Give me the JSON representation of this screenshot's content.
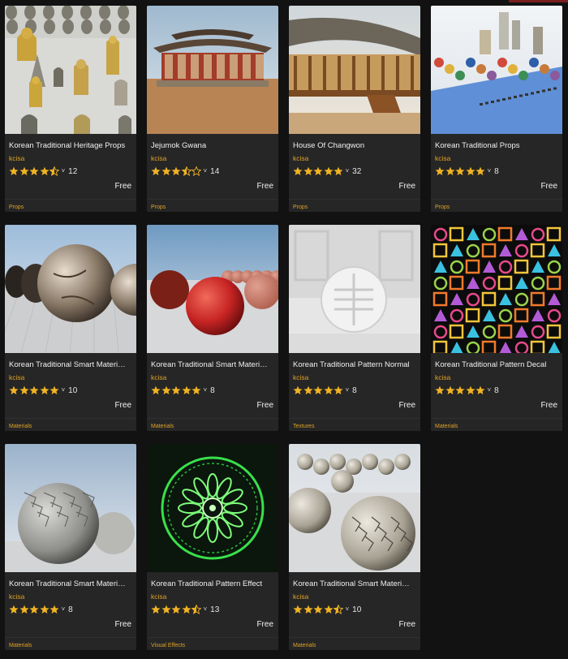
{
  "colors": {
    "page_bg": "#121212",
    "card_bg": "#262626",
    "accent": "#e0a224",
    "star": "#f0b323"
  },
  "products": [
    {
      "title": "Korean Traditional Heritage Props",
      "seller": "kcisa",
      "rating": 4.5,
      "reviews": "12",
      "price": "Free",
      "category": "Props",
      "thumb": "heritage-props"
    },
    {
      "title": "Jejumok Gwana",
      "seller": "kcisa",
      "rating": 3.5,
      "reviews": "14",
      "price": "Free",
      "category": "Props",
      "thumb": "jejumok-gwana"
    },
    {
      "title": "House Of Changwon",
      "seller": "kcisa",
      "rating": 5,
      "reviews": "32",
      "price": "Free",
      "category": "Props",
      "thumb": "house-changwon"
    },
    {
      "title": "Korean Traditional Props",
      "seller": "kcisa",
      "rating": 5,
      "reviews": "8",
      "price": "Free",
      "category": "Props",
      "thumb": "traditional-props"
    },
    {
      "title": "Korean Traditional Smart Materi…",
      "seller": "kcisa",
      "rating": 5,
      "reviews": "10",
      "price": "Free",
      "category": "Materials",
      "thumb": "marble-spheres"
    },
    {
      "title": "Korean Traditional Smart Materi…",
      "seller": "kcisa",
      "rating": 5,
      "reviews": "8",
      "price": "Free",
      "category": "Materials",
      "thumb": "red-spheres"
    },
    {
      "title": "Korean Traditional Pattern Normal",
      "seller": "kcisa",
      "rating": 5,
      "reviews": "8",
      "price": "Free",
      "category": "Textures",
      "thumb": "pattern-normal"
    },
    {
      "title": "Korean Traditional Pattern Decal",
      "seller": "kcisa",
      "rating": 5,
      "reviews": "8",
      "price": "Free",
      "category": "Materials",
      "thumb": "pattern-decal"
    },
    {
      "title": "Korean Traditional Smart Materi…",
      "seller": "kcisa",
      "rating": 5,
      "reviews": "8",
      "price": "Free",
      "category": "Materials",
      "thumb": "stone-sphere"
    },
    {
      "title": "Korean Traditional Pattern Effect",
      "seller": "kcisa",
      "rating": 4.5,
      "reviews": "13",
      "price": "Free",
      "category": "Visual Effects",
      "thumb": "pattern-effect"
    },
    {
      "title": "Korean Traditional Smart Materi…",
      "seller": "kcisa",
      "rating": 4.5,
      "reviews": "10",
      "price": "Free",
      "category": "Materials",
      "thumb": "cracked-spheres"
    }
  ]
}
